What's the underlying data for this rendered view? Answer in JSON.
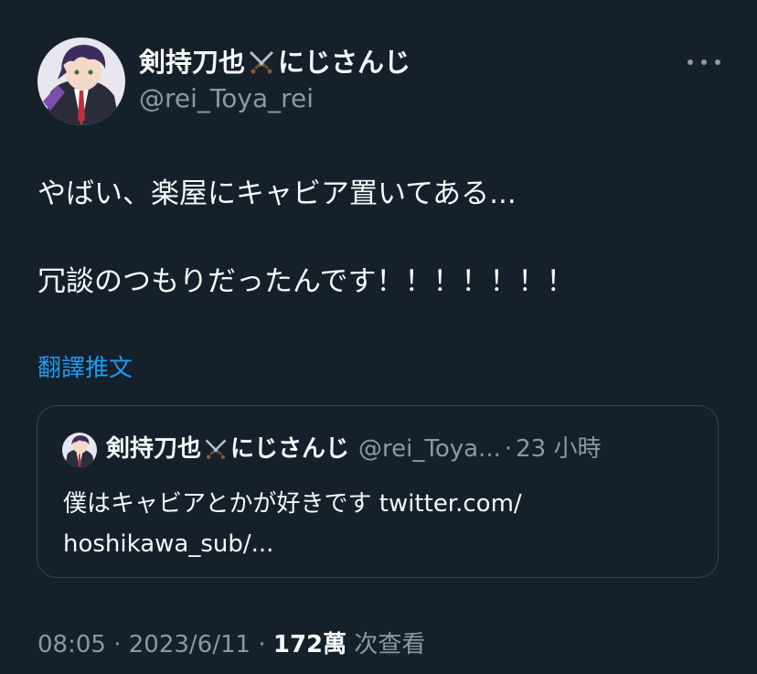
{
  "author": {
    "display_name_prefix": "剣持刀也",
    "display_name_suffix": "にじさんじ",
    "emoji_icon": "crossed-swords-icon",
    "handle": "@rei_Toya_rei"
  },
  "more_icon": "more-horizontal-icon",
  "tweet": {
    "line1": "やばい、楽屋にキャビア置いてある...",
    "line2": "冗談のつもりだったんです！！！！！！！"
  },
  "translate_label": "翻譯推文",
  "quote": {
    "display_name_prefix": "剣持刀也",
    "display_name_suffix": "にじさんじ",
    "handle": "@rei_Toya...",
    "separator": "·",
    "time": "23 小時",
    "text_line1": "僕はキャビアとかが好きです twitter.com/",
    "text_line2": "hoshikawa_sub/..."
  },
  "footer": {
    "time": "08:05",
    "sep1": "·",
    "date": "2023/6/11",
    "sep2": "·",
    "views_count": "172萬",
    "views_label": "次查看"
  },
  "colors": {
    "background": "#15202b",
    "text": "#f7f9f9",
    "secondary": "#8b98a5",
    "link": "#1d9bf0",
    "border": "#38444d"
  }
}
